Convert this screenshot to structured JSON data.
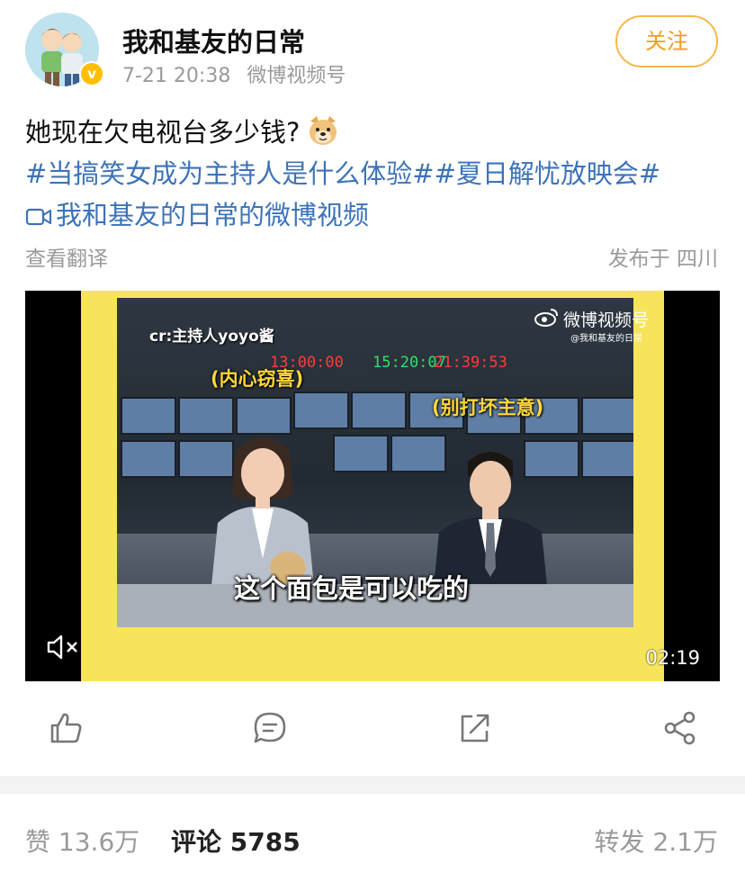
{
  "post": {
    "author": "我和基友的日常",
    "time": "7-21 20:38",
    "source": "微博视频号",
    "follow_label": "关注",
    "text": "她现在欠电视台多少钱?",
    "topics": "#当搞笑女成为主持人是什么体验##夏日解忧放映会#",
    "video_link": "我和基友的日常的微博视频",
    "translate_label": "查看翻译",
    "location": "发布于 四川"
  },
  "video": {
    "caption_top_left": "cr:主持人yoyo酱",
    "caption_female": "(内心窃喜)",
    "caption_male": "(别打坏主意)",
    "subtitle": "这个面包是可以吃的",
    "watermark": "微博视频号",
    "watermark_handle": "@我和基友的日常",
    "clock_red_1": "13:00:00",
    "clock_green": "15:20:07",
    "clock_red_2": "21:39:53",
    "duration": "02:19",
    "muted": true
  },
  "actions": {
    "like_icon": "thumbs-up-icon",
    "comment_icon": "comment-icon",
    "repost_icon": "repost-icon",
    "share_icon": "share-icon"
  },
  "stats": {
    "likes_label": "赞",
    "likes_value": "13.6万",
    "comments_label": "评论",
    "comments_value": "5785",
    "reposts_label": "转发",
    "reposts_value": "2.1万"
  },
  "colors": {
    "link": "#3d73b8",
    "follow": "#f09d1b",
    "verified": "#ffbf00"
  }
}
